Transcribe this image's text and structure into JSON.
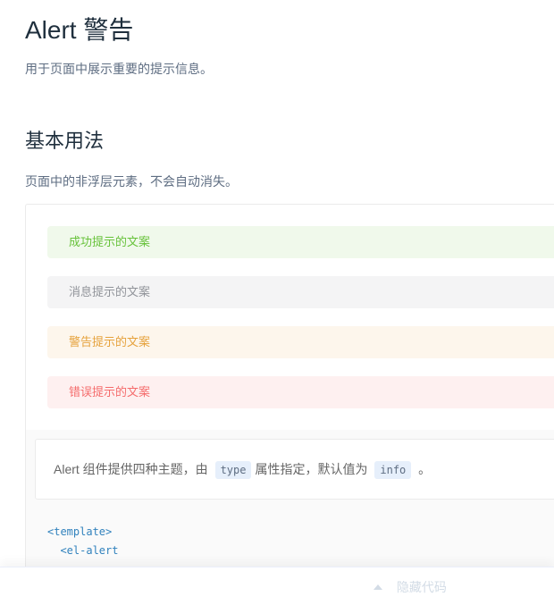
{
  "page": {
    "title": "Alert 警告",
    "description": "用于页面中展示重要的提示信息。"
  },
  "section": {
    "title": "基本用法",
    "description": "页面中的非浮层元素，不会自动消失。"
  },
  "alerts": [
    {
      "type": "success",
      "text": "成功提示的文案",
      "color": "#67c23a",
      "background": "#f0f9eb"
    },
    {
      "type": "info",
      "text": "消息提示的文案",
      "color": "#909399",
      "background": "#f4f4f5"
    },
    {
      "type": "warning",
      "text": "警告提示的文案",
      "color": "#e6a23c",
      "background": "#fdf6ec"
    },
    {
      "type": "error",
      "text": "错误提示的文案",
      "color": "#f56c6c",
      "background": "#fef0f0"
    }
  ],
  "meta": {
    "text_before": "Alert 组件提供四种主题，由",
    "code_type": "type",
    "text_middle": "属性指定，默认值为",
    "code_default": "info",
    "text_after": "。"
  },
  "code": {
    "line1": "<template>",
    "line2": "  <el-alert"
  },
  "control": {
    "label": "隐藏代码",
    "icon": "caret-up-icon"
  }
}
